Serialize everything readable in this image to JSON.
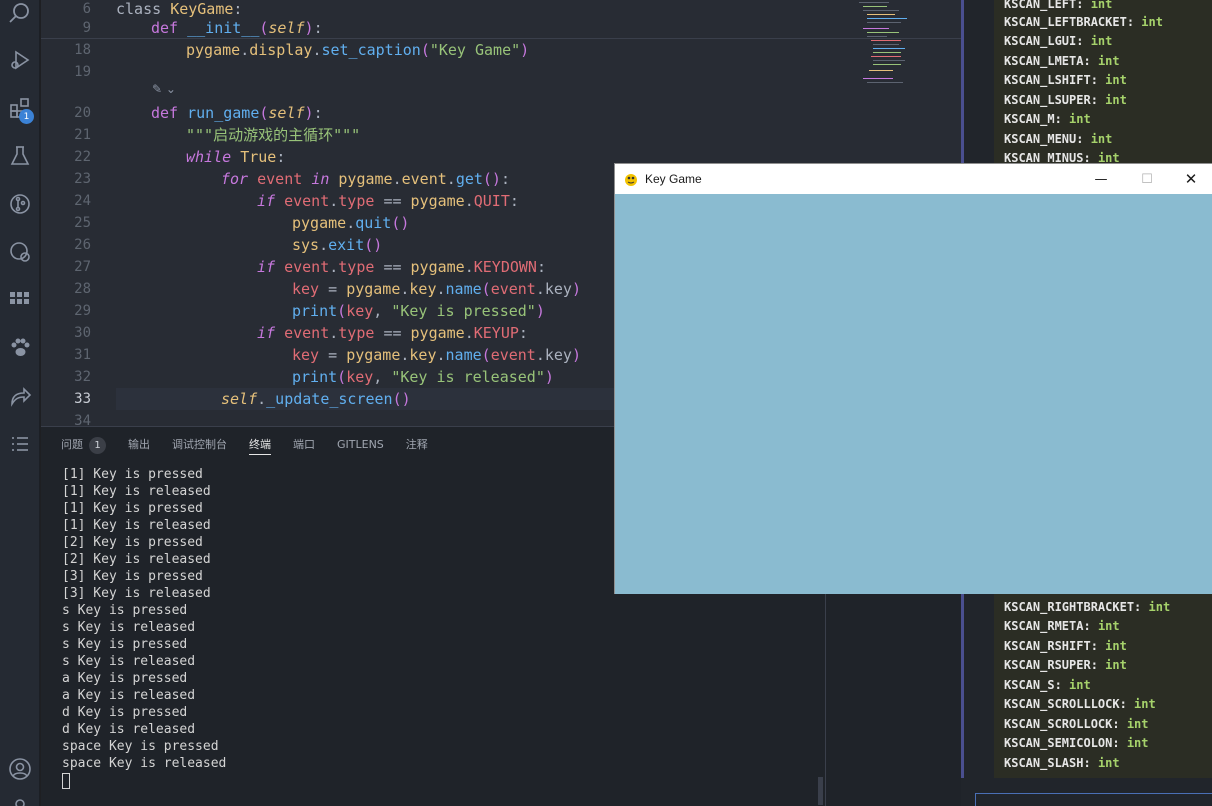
{
  "activity_bar": {
    "icons": [
      "search-icon",
      "run-debug-icon",
      "extensions-icon",
      "testing-icon",
      "source-control-icon",
      "remote-icon",
      "grid-icon",
      "paw-icon",
      "share-icon",
      "list-icon",
      "account-icon",
      "settings-icon"
    ],
    "extensions_badge": "1"
  },
  "editor": {
    "lines": [
      {
        "n": "6"
      },
      {
        "n": "9"
      },
      {
        "n": "18"
      },
      {
        "n": "19"
      },
      {
        "n": "20"
      },
      {
        "n": "21"
      },
      {
        "n": "22"
      },
      {
        "n": "23"
      },
      {
        "n": "24"
      },
      {
        "n": "25"
      },
      {
        "n": "26"
      },
      {
        "n": "27"
      },
      {
        "n": "28"
      },
      {
        "n": "29"
      },
      {
        "n": "30"
      },
      {
        "n": "31"
      },
      {
        "n": "32"
      },
      {
        "n": "33"
      },
      {
        "n": "34"
      }
    ],
    "code": {
      "l6_class": "class",
      "l6_name": "KeyGame",
      "l9_def": "def",
      "l9_fn": "__init__",
      "l9_self": "self",
      "l18_obj": "pygame",
      "l18_attr": "display",
      "l18_fn": "set_caption",
      "l18_str": "\"Key Game\"",
      "l20_def": "def",
      "l20_fn": "run_game",
      "l20_self": "self",
      "l21_doc": "\"\"\"启动游戏的主循环\"\"\"",
      "l22_while": "while",
      "l22_true": "True",
      "l23_for": "for",
      "l23_var": "event",
      "l23_in": "in",
      "l23_obj": "pygame",
      "l23_attr": "event",
      "l23_fn": "get",
      "l24_if": "if",
      "l24_var": "event",
      "l24_attr": "type",
      "l24_obj": "pygame",
      "l24_const": "QUIT",
      "l25_obj": "pygame",
      "l25_fn": "quit",
      "l26_obj": "sys",
      "l26_fn": "exit",
      "l27_if": "if",
      "l27_var": "event",
      "l27_attr": "type",
      "l27_obj": "pygame",
      "l27_const": "KEYDOWN",
      "l28_var": "key",
      "l28_obj": "pygame",
      "l28_attr": "key",
      "l28_fn": "name",
      "l28_arg": "event",
      "l28_argattr": "key",
      "l29_fn": "print",
      "l29_var": "key",
      "l29_str": "\"Key is pressed\"",
      "l30_if": "if",
      "l30_var": "event",
      "l30_attr": "type",
      "l30_obj": "pygame",
      "l30_const": "KEYUP",
      "l31_var": "key",
      "l31_obj": "pygame",
      "l31_attr": "key",
      "l31_fn": "name",
      "l31_arg": "event",
      "l31_argattr": "key",
      "l32_fn": "print",
      "l32_var": "key",
      "l32_str": "\"Key is released\"",
      "l33_self": "self",
      "l33_fn": "_update_screen"
    }
  },
  "right_panel": {
    "items": [
      {
        "name": "KSCAN_LEFT",
        "type": "int"
      },
      {
        "name": "KSCAN_LEFTBRACKET",
        "type": "int"
      },
      {
        "name": "KSCAN_LGUI",
        "type": "int"
      },
      {
        "name": "KSCAN_LMETA",
        "type": "int"
      },
      {
        "name": "KSCAN_LSHIFT",
        "type": "int"
      },
      {
        "name": "KSCAN_LSUPER",
        "type": "int"
      },
      {
        "name": "KSCAN_M",
        "type": "int"
      },
      {
        "name": "KSCAN_MENU",
        "type": "int"
      },
      {
        "name": "KSCAN_MINUS",
        "type": "int"
      },
      {
        "name": "KSCAN_RIGHTBRACKET",
        "type": "int"
      },
      {
        "name": "KSCAN_RMETA",
        "type": "int"
      },
      {
        "name": "KSCAN_RSHIFT",
        "type": "int"
      },
      {
        "name": "KSCAN_RSUPER",
        "type": "int"
      },
      {
        "name": "KSCAN_S",
        "type": "int"
      },
      {
        "name": "KSCAN_SCROLLLOCK",
        "type": "int"
      },
      {
        "name": "KSCAN_SCROLLOCK",
        "type": "int"
      },
      {
        "name": "KSCAN_SEMICOLON",
        "type": "int"
      },
      {
        "name": "KSCAN_SLASH",
        "type": "int"
      }
    ]
  },
  "panel": {
    "tabs": [
      {
        "label": "问题",
        "count": "1"
      },
      {
        "label": "输出"
      },
      {
        "label": "调试控制台"
      },
      {
        "label": "终端"
      },
      {
        "label": "端口"
      },
      {
        "label": "GITLENS"
      },
      {
        "label": "注释"
      }
    ],
    "active_tab": "终端",
    "terminal_lines": [
      "[1] Key is pressed",
      "[1] Key is released",
      "[1] Key is pressed",
      "[1] Key is released",
      "[2] Key is pressed",
      "[2] Key is released",
      "[3] Key is pressed",
      "[3] Key is released",
      "s Key is pressed",
      "s Key is released",
      "s Key is pressed",
      "s Key is released",
      "a Key is pressed",
      "a Key is released",
      "d Key is pressed",
      "d Key is released",
      "space Key is pressed",
      "space Key is released"
    ]
  },
  "game_window": {
    "title": "Key Game",
    "minimize": "—",
    "maximize": "☐",
    "close": "✕",
    "bg_color": "#8abbd0"
  }
}
